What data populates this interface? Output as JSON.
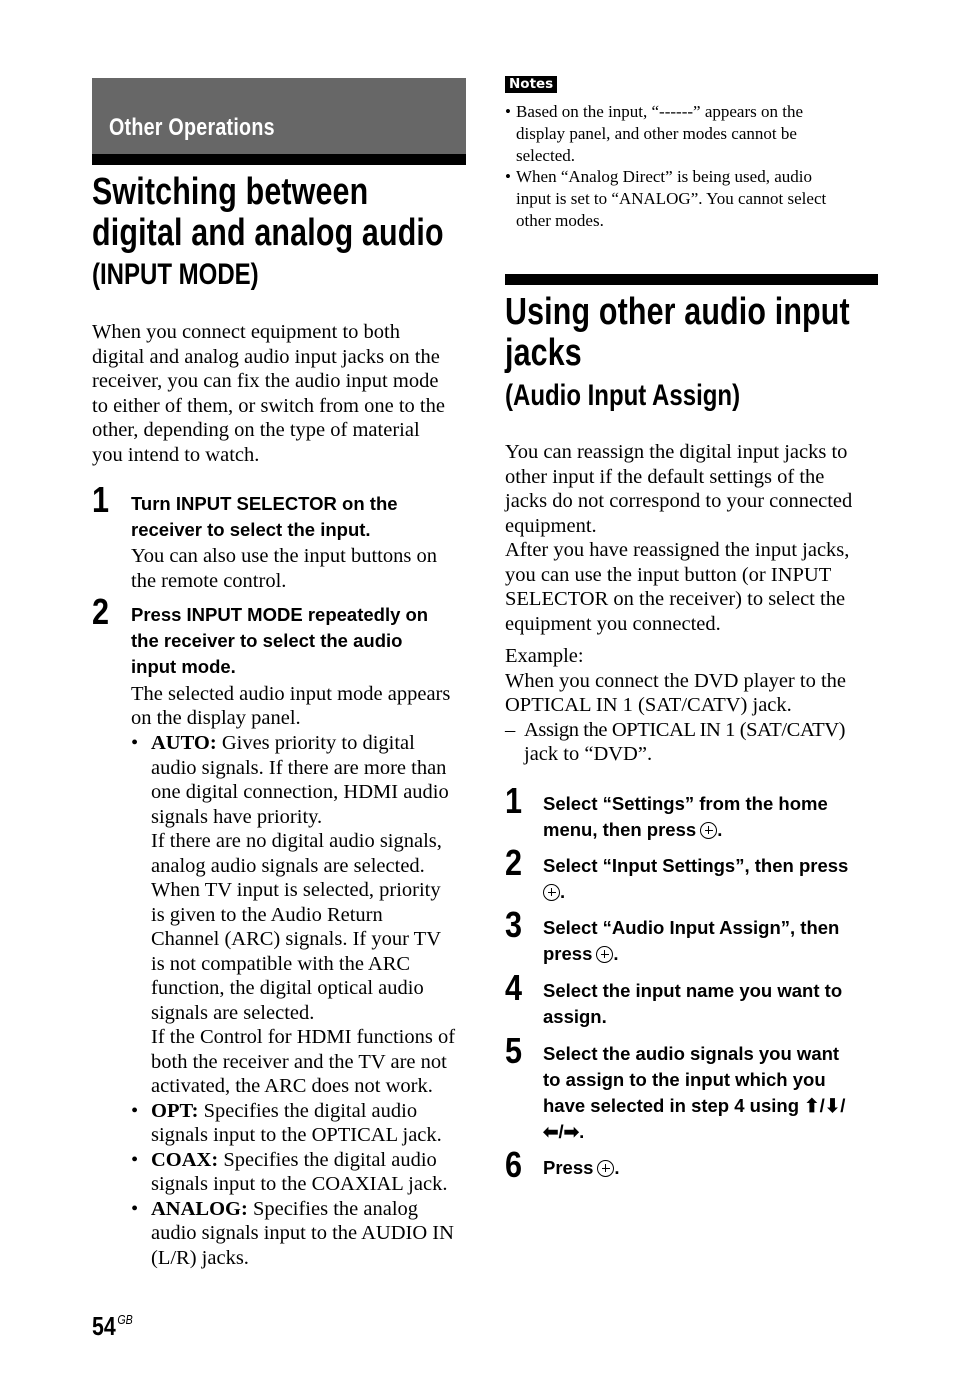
{
  "section": {
    "label": "Other Operations"
  },
  "left": {
    "title_lines": [
      "Switching between",
      "digital and analog audio"
    ],
    "subtitle": "(INPUT MODE)",
    "intro": [
      "When you connect equipment to both",
      "digital and analog audio input jacks on the",
      "receiver, you can fix the audio input mode",
      "to either of them, or switch from one to the",
      "other, depending on the type of material",
      "you intend to watch."
    ],
    "steps": [
      {
        "num": "1",
        "title_lines": [
          "Turn INPUT SELECTOR on the",
          "receiver to select the input."
        ],
        "desc_lines": [
          "You can also use the input buttons on",
          "the remote control."
        ]
      },
      {
        "num": "2",
        "title_lines": [
          "Press INPUT MODE repeatedly on",
          "the receiver to select the audio",
          "input mode."
        ],
        "desc_lines": [
          "The selected audio input mode appears",
          "on the display panel."
        ]
      }
    ],
    "modes": [
      {
        "bullet": "•",
        "term": "AUTO:",
        "lines": [
          " Gives priority to digital",
          "audio signals. If there are more than",
          "one digital connection, HDMI audio",
          "signals have priority.",
          "If there are no digital audio signals,",
          "analog audio signals are selected.",
          "When TV input is selected, priority",
          "is given to the Audio Return",
          "Channel (ARC) signals. If your TV",
          "is not compatible with the ARC",
          "function, the digital optical audio",
          "signals are selected.",
          "If the Control for HDMI functions of",
          "both the receiver and the TV are not",
          "activated, the ARC does not work."
        ]
      },
      {
        "bullet": "•",
        "term": "OPT:",
        "lines": [
          " Specifies the digital audio",
          "signals input to the OPTICAL jack."
        ]
      },
      {
        "bullet": "•",
        "term": "COAX:",
        "lines": [
          " Specifies the digital audio",
          "signals input to the COAXIAL jack."
        ]
      },
      {
        "bullet": "•",
        "term": "ANALOG:",
        "lines": [
          " Specifies the analog",
          "audio signals input to the AUDIO IN",
          "(L/R) jacks."
        ]
      }
    ]
  },
  "right": {
    "notes_label": "Notes",
    "notes": [
      {
        "bullet": "•",
        "lines": [
          "Based on the input, “------” appears on the",
          "display panel, and other modes cannot be",
          "selected."
        ]
      },
      {
        "bullet": "•",
        "lines": [
          "When “Analog Direct” is being used, audio",
          "input is set to “ANALOG”. You cannot select",
          "other modes."
        ]
      }
    ],
    "title_lines": [
      "Using other audio input",
      "jacks"
    ],
    "subtitle": "(Audio Input Assign)",
    "intro": [
      "You can reassign the digital input jacks to",
      "other input if the default settings of the",
      "jacks do not correspond to your connected",
      "equipment.",
      "After you have reassigned the input jacks,",
      "you can use the input button (or INPUT",
      "SELECTOR on the receiver) to select the",
      "equipment you connected."
    ],
    "example_label": "Example:",
    "example_lines": [
      "When you connect the DVD player to the",
      "OPTICAL IN 1 (SAT/CATV) jack."
    ],
    "example_dash": "–",
    "example_assign": [
      "Assign the OPTICAL IN 1 (SAT/CATV)",
      "jack to “DVD”."
    ],
    "steps": [
      {
        "num": "1",
        "lines": [
          "Select “Settings” from the home",
          "menu, then press"
        ],
        "enter_icon": true,
        "tail": "."
      },
      {
        "num": "2",
        "lines": [
          "Select “Input Settings”, then press",
          ""
        ],
        "enter_icon": true,
        "tail": "."
      },
      {
        "num": "3",
        "lines": [
          "Select “Audio Input Assign”, then",
          "press"
        ],
        "enter_icon": true,
        "tail": "."
      },
      {
        "num": "4",
        "lines": [
          "Select the input name you want to",
          "assign."
        ],
        "enter_icon": false,
        "tail": ""
      },
      {
        "num": "5",
        "lines": [
          "Select the audio signals you want",
          "to assign to the input which you",
          "have selected in step 4 using ⬆/⬇/",
          "⬅/➡."
        ],
        "enter_icon": false,
        "tail": ""
      },
      {
        "num": "6",
        "lines": [
          "Press"
        ],
        "enter_icon": true,
        "tail": "."
      }
    ]
  },
  "footer": {
    "page": "54",
    "region": "GB"
  }
}
